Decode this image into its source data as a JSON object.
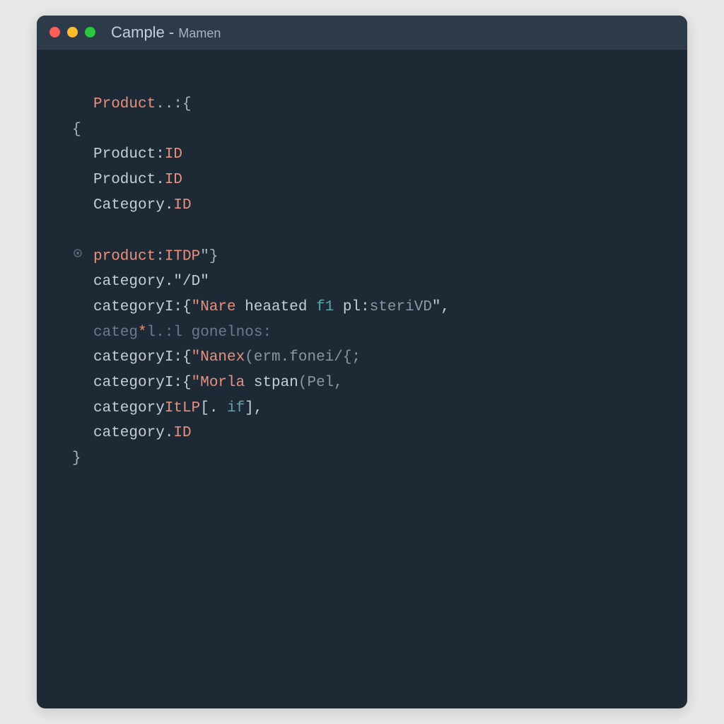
{
  "window": {
    "title_main": "Cample",
    "title_sep": " - ",
    "title_sub": "Mamen"
  },
  "colors": {
    "background": "#e8e8e8",
    "window_bg": "#1e2936",
    "titlebar_bg": "#2c3a49",
    "traffic_red": "#ff5f57",
    "traffic_yellow": "#febc2e",
    "traffic_green": "#28c840",
    "keyword": "#e8907d",
    "text": "#c5cdd6",
    "comment": "#6b7a8a",
    "teal": "#5aa5a5"
  },
  "code": {
    "line1_a": "Product",
    "line1_b": "..:{",
    "line2": "{",
    "line3_a": "Product:",
    "line3_b": "ID",
    "line4_a": "Product.",
    "line4_b": "ID",
    "line5_a": "Category.",
    "line5_b": "ID",
    "line6_a": "product",
    "line6_b": ":",
    "line6_c": "ITDP",
    "line6_d": "\"}",
    "line7_a": "category.",
    "line7_b": "\"/D\"",
    "line8_a": "categoryI:{",
    "line8_b": "\"Nare",
    "line8_c": " heaated ",
    "line8_d": "f1",
    "line8_e": " pl:",
    "line8_f": "steriVD",
    "line8_g": "\",",
    "line9_a": "categ",
    "line9_b": "*",
    "line9_c": "l.:l gonelnos:",
    "line10_a": "categoryI:{",
    "line10_b": "\"Nanex",
    "line10_c": "(erm.fonei/{;",
    "line11_a": "categoryI:{",
    "line11_b": "\"Morla",
    "line11_c": " stpan",
    "line11_d": "(Pel,",
    "line12_a": "category",
    "line12_b": "ItLP",
    "line12_c": "[. ",
    "line12_d": "if",
    "line12_e": "],",
    "line13_a": "category.",
    "line13_b": "ID",
    "line14": "}"
  }
}
